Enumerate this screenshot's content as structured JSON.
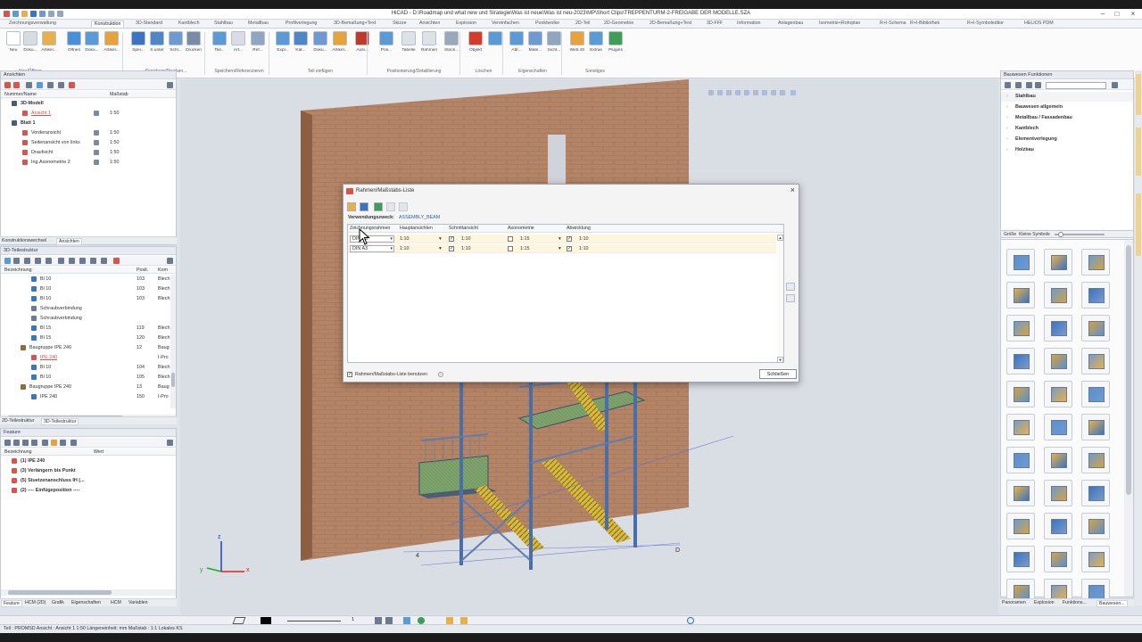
{
  "app": {
    "title": "HiCAD - D:\\Roadmap und what new und Strategie\\Was ist neue\\Was ist neu-2023\\MP\\Short Clips\\TREPPENTURM-2-FREIGABE DER MODELLE.SZA"
  },
  "ribbon_tabs": [
    "Zeichnungsverwaltung",
    "Konstruktion",
    "3D-Standard",
    "Kantblech",
    "Stahlbau",
    "Metallbau",
    "Profilverlegung",
    "3D-Bemaßung+Text",
    "Skizze",
    "Ansichten",
    "Explosion",
    "Vereinfachen",
    "Punktwolke",
    "2D-Teil",
    "2D-Geometrie",
    "2D-Bemaßung+Text",
    "3D-FFF",
    "Information",
    "Anlagenbau",
    "Isometrie+Rohrplan",
    "R+I-Schema",
    "R+I-Bibliothek",
    "R+I-Symboleditor",
    "HELIOS PDM"
  ],
  "ribbon_buttons": [
    {
      "label": "Neu",
      "color": "#ffffff"
    },
    {
      "label": "Doku...",
      "color": "#d7dbe2"
    },
    {
      "label": "Artikel...",
      "color": "#e8b04a"
    },
    {
      "label": "Öffnen",
      "color": "#4a90d9"
    },
    {
      "label": "Doku...",
      "color": "#5b9bd5"
    },
    {
      "label": "Artikel...",
      "color": "#e8a23a"
    },
    {
      "label": "Spei...",
      "color": "#3a74c2"
    },
    {
      "label": "S.unter",
      "color": "#4f86c6"
    },
    {
      "label": "Schl...",
      "color": "#6d9bd1"
    },
    {
      "label": "Drucken",
      "color": "#7a8ca3"
    },
    {
      "label": "Teil...",
      "color": "#5b9bd5"
    },
    {
      "label": "Art...",
      "color": "#d9dde3"
    },
    {
      "label": "Ref...",
      "color": "#8fa6c3"
    },
    {
      "label": "Expl...",
      "color": "#5b9bd5"
    },
    {
      "label": "Kat...",
      "color": "#4f86c6"
    },
    {
      "label": "Doku...",
      "color": "#6d9bd1"
    },
    {
      "label": "Artikel...",
      "color": "#e8a23a"
    },
    {
      "label": "Ausl...",
      "color": "#c0392b"
    },
    {
      "label": "Pos...",
      "color": "#5b9bd5"
    },
    {
      "label": "Tabelle",
      "color": "#dde2e8"
    },
    {
      "label": "Rahmen",
      "color": "#dde2e8"
    },
    {
      "label": "Stück...",
      "color": "#9aa8ba"
    },
    {
      "label": "Objekt",
      "color": "#d63a2a"
    },
    {
      "label": "",
      "color": "#5b9bd5"
    },
    {
      "label": "Attr...",
      "color": "#5b9bd5"
    },
    {
      "label": "Mate...",
      "color": "#6d9bd1"
    },
    {
      "label": "Sicht...",
      "color": "#8fa6c3"
    },
    {
      "label": "Welt.4S",
      "color": "#e8a23a"
    },
    {
      "label": "Extras",
      "color": "#5b9bd5"
    },
    {
      "label": "Plugins",
      "color": "#3f9e55"
    }
  ],
  "ribbon_groups": [
    "Neu/Öffnen",
    "Speichern/Drucken...",
    "Speichern/Referenzieren",
    "Teil einfügen",
    "Positionierung/Detaillierung",
    "Löschen",
    "Eigenschaften",
    "Sonstiges"
  ],
  "ansichten_panel": {
    "title": "Ansichten",
    "columns": [
      "Nummer/Name",
      "Maßstab"
    ],
    "rows": [
      {
        "name": "3D-Modell",
        "scale": "",
        "level": 0,
        "bold": true,
        "color": "#4a5a7a"
      },
      {
        "name": "Ansicht 1",
        "scale": "1:50",
        "level": 1,
        "bold": false,
        "color": "#d9534f",
        "red": true
      },
      {
        "name": "Blatt 1",
        "scale": "",
        "level": 0,
        "bold": true,
        "color": "#4a5a7a"
      },
      {
        "name": "Vorderansicht",
        "scale": "1:50",
        "level": 1,
        "bold": false,
        "color": "#d9534f"
      },
      {
        "name": "Seitenansicht von links",
        "scale": "1:50",
        "level": 1,
        "bold": false,
        "color": "#d9534f"
      },
      {
        "name": "Draufsicht",
        "scale": "1:50",
        "level": 1,
        "bold": false,
        "color": "#d9534f"
      },
      {
        "name": "Ing.Axonometrie 2",
        "scale": "1:50",
        "level": 1,
        "bold": false,
        "color": "#d9534f"
      }
    ],
    "tabs": [
      "Konstruktionswechsel",
      "Ansichten"
    ]
  },
  "teilestruktur_panel": {
    "title": "3D-Teilestruktur",
    "columns": [
      "Bezeichnung",
      "Posit.",
      "Kom"
    ],
    "rows": [
      {
        "name": "Bl 10",
        "pos": "103",
        "kom": "Blech",
        "icon": "#3a74c2",
        "indent": 2
      },
      {
        "name": "Bl 10",
        "pos": "103",
        "kom": "Blech",
        "icon": "#3a74c2",
        "indent": 2
      },
      {
        "name": "Bl 10",
        "pos": "103",
        "kom": "Blech",
        "icon": "#3a74c2",
        "indent": 2
      },
      {
        "name": "Schraubverbindung",
        "pos": "",
        "kom": "",
        "icon": "#6b7a8f",
        "indent": 2
      },
      {
        "name": "Schraubverbindung",
        "pos": "",
        "kom": "",
        "icon": "#6b7a8f",
        "indent": 2
      },
      {
        "name": "Bl 15",
        "pos": "119",
        "kom": "Blech",
        "icon": "#3a74c2",
        "indent": 2
      },
      {
        "name": "Bl 15",
        "pos": "120",
        "kom": "Blech",
        "icon": "#3a74c2",
        "indent": 2
      },
      {
        "name": "Baugruppe IPE 240",
        "pos": "12",
        "kom": "Baug",
        "icon": "#8a6d3b",
        "indent": 1
      },
      {
        "name": "IPE 240",
        "pos": "",
        "kom": "I-Pro",
        "icon": "#d9534f",
        "indent": 2,
        "red": true
      },
      {
        "name": "Bl 10",
        "pos": "104",
        "kom": "Blech",
        "icon": "#3a74c2",
        "indent": 2
      },
      {
        "name": "Bl 10",
        "pos": "105",
        "kom": "Blech",
        "icon": "#3a74c2",
        "indent": 2
      },
      {
        "name": "Baugruppe IPE 240",
        "pos": "13",
        "kom": "Baug",
        "icon": "#8a6d3b",
        "indent": 1
      },
      {
        "name": "IPE 240",
        "pos": "150",
        "kom": "I-Pro",
        "icon": "#3a74c2",
        "indent": 2
      }
    ],
    "tabs": [
      "2D-Teilestruktur",
      "3D-Teilestruktur"
    ]
  },
  "feature_panel": {
    "title": "Feature",
    "columns": [
      "Bezeichnung",
      "Wert"
    ],
    "rows": [
      {
        "name": "(1) IPE 240",
        "color": "#d9534f"
      },
      {
        "name": "(3) Verlängern bis Punkt",
        "color": "#d9534f"
      },
      {
        "name": "(5) Stuetzenanschluss IH (...",
        "color": "#d9534f"
      },
      {
        "name": "(2) ---- Einfügeposition ----",
        "color": "#d9534f"
      }
    ],
    "tabs": [
      "Feature",
      "HCM (2D)",
      "Grafik",
      "Eigenschaften",
      "HCM",
      "Variablen"
    ]
  },
  "dialog": {
    "title": "Rahmen/Maßstabs-Liste",
    "usage_label": "Verwendungszweck:",
    "usage_value": "ASSEMBLY_BEAM",
    "columns": [
      "Zeichnungsrahmen",
      "Hauptansichten",
      "Schnittansicht",
      "Axonometrie",
      "Abwicklung"
    ],
    "rows": [
      {
        "frame": "DIN A3",
        "main": "1:10",
        "section_checked": true,
        "section": "1:10",
        "axo_checked": false,
        "axo": "1:15",
        "dev_checked": true,
        "dev": "1:10"
      },
      {
        "frame": "DIN A3",
        "main": "1:10",
        "section_checked": true,
        "section": "1:10",
        "axo_checked": false,
        "axo": "1:15",
        "dev_checked": true,
        "dev": "1:10"
      }
    ],
    "use_list_label": "Rahmen/Maßstabs-Liste benutzen",
    "use_list_checked": true,
    "close_label": "Schließen"
  },
  "right_panel": {
    "title": "Bauwesen Funktionen",
    "items": [
      "Stahlbau",
      "Bauwesen allgemein",
      "Metallbau / Fassadenbau",
      "Kantblech",
      "Elementverlegung",
      "Holzbau"
    ],
    "size_label": "Größe",
    "size_value": "Kleine Symbole",
    "side_tabs": [
      "Konstruktion",
      "Metallbau Konstruktion",
      "Stahl-/Kunststoffzeichnung"
    ],
    "bottom_tabs": [
      "Panoramen",
      "Explosion",
      "Funktions...",
      "Bauwesen..."
    ]
  },
  "axis": {
    "x": "x",
    "y": "y",
    "z": "z"
  },
  "status": {
    "text": "Teil : PROMSD   Ansicht : Ansicht 1 1:50  Längeneinheit: mm  Maßstab : 1:1  Lokales KS"
  },
  "bottom_toolbar": {
    "page": "1"
  }
}
